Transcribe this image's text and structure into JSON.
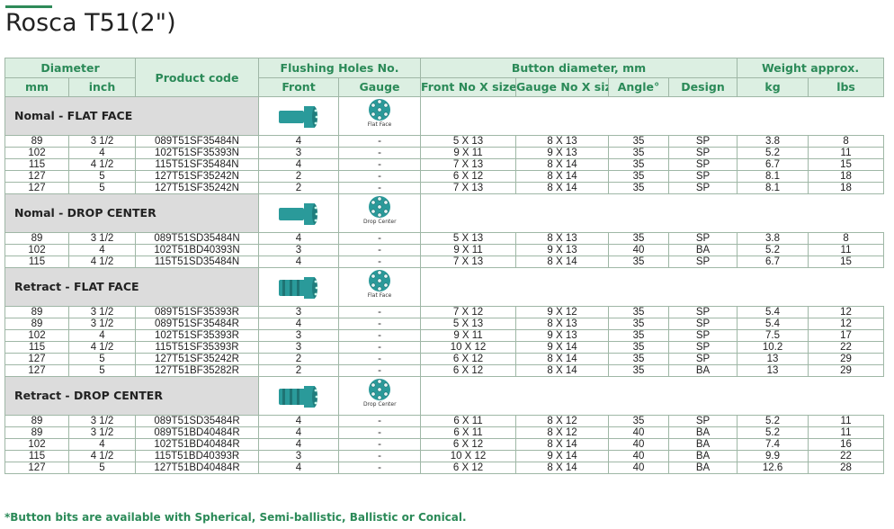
{
  "title": "Rosca T51(2\")",
  "header": {
    "diameter": "Diameter",
    "mm": "mm",
    "inch": "inch",
    "product_code": "Product code",
    "flushing": "Flushing Holes No.",
    "front": "Front",
    "gauge": "Gauge",
    "button_diameter": "Button diameter, mm",
    "front_no_size": "Front No X size",
    "gauge_no_size": "Gauge No X size",
    "angle": "Angle°",
    "design": "Design",
    "weight": "Weight approx.",
    "kg": "kg",
    "lbs": "lbs"
  },
  "sections": [
    {
      "label": "Nomal - FLAT FACE",
      "icon": "flat-face-bit-icon",
      "face_caption": "Flat Face",
      "rows": [
        [
          "89",
          "3 1/2",
          "089T51SF35484N",
          "4",
          "-",
          "5 X 13",
          "8 X 13",
          "35",
          "SP",
          "3.8",
          "8"
        ],
        [
          "102",
          "4",
          "102T51SF35393N",
          "3",
          "-",
          "9 X 11",
          "9 X 13",
          "35",
          "SP",
          "5.2",
          "11"
        ],
        [
          "115",
          "4 1/2",
          "115T51SF35484N",
          "4",
          "-",
          "7 X 13",
          "8 X 14",
          "35",
          "SP",
          "6.7",
          "15"
        ],
        [
          "127",
          "5",
          "127T51SF35242N",
          "2",
          "-",
          "6 X 12",
          "8 X 14",
          "35",
          "SP",
          "8.1",
          "18"
        ],
        [
          "127",
          "5",
          "127T51SF35242N",
          "2",
          "-",
          "7 X 13",
          "8 X 14",
          "35",
          "SP",
          "8.1",
          "18"
        ]
      ]
    },
    {
      "label": "Nomal - DROP CENTER",
      "icon": "drop-center-bit-icon",
      "face_caption": "Drop Center",
      "rows": [
        [
          "89",
          "3 1/2",
          "089T51SD35484N",
          "4",
          "-",
          "5 X 13",
          "8 X 13",
          "35",
          "SP",
          "3.8",
          "8"
        ],
        [
          "102",
          "4",
          "102T51BD40393N",
          "3",
          "-",
          "9 X 11",
          "9 X 13",
          "40",
          "BA",
          "5.2",
          "11"
        ],
        [
          "115",
          "4 1/2",
          "115T51SD35484N",
          "4",
          "-",
          "7 X 13",
          "8 X 14",
          "35",
          "SP",
          "6.7",
          "15"
        ]
      ]
    },
    {
      "label": "Retract - FLAT FACE",
      "icon": "retract-flat-face-bit-icon",
      "face_caption": "Flat Face",
      "rows": [
        [
          "89",
          "3 1/2",
          "089T51SF35393R",
          "3",
          "-",
          "7 X 12",
          "9 X 12",
          "35",
          "SP",
          "5.4",
          "12"
        ],
        [
          "89",
          "3 1/2",
          "089T51SF35484R",
          "4",
          "-",
          "5 X 13",
          "8 X 13",
          "35",
          "SP",
          "5.4",
          "12"
        ],
        [
          "102",
          "4",
          "102T51SF35393R",
          "3",
          "-",
          "9 X 11",
          "9 X 13",
          "35",
          "SP",
          "7.5",
          "17"
        ],
        [
          "115",
          "4 1/2",
          "115T51SF35393R",
          "3",
          "-",
          "10 X 12",
          "9 X 14",
          "35",
          "SP",
          "10.2",
          "22"
        ],
        [
          "127",
          "5",
          "127T51SF35242R",
          "2",
          "-",
          "6 X 12",
          "8 X 14",
          "35",
          "SP",
          "13",
          "29"
        ],
        [
          "127",
          "5",
          "127T51BF35282R",
          "2",
          "-",
          "6 X 12",
          "8 X 14",
          "35",
          "BA",
          "13",
          "29"
        ]
      ]
    },
    {
      "label": "Retract - DROP CENTER",
      "icon": "retract-drop-center-bit-icon",
      "face_caption": "Drop Center",
      "rows": [
        [
          "89",
          "3 1/2",
          "089T51SD35484R",
          "4",
          "-",
          "6 X 11",
          "8 X 12",
          "35",
          "SP",
          "5.2",
          "11"
        ],
        [
          "89",
          "3 1/2",
          "089T51BD40484R",
          "4",
          "-",
          "6 X 11",
          "8 X 12",
          "40",
          "BA",
          "5.2",
          "11"
        ],
        [
          "102",
          "4",
          "102T51BD40484R",
          "4",
          "-",
          "6 X 12",
          "8 X 14",
          "40",
          "BA",
          "7.4",
          "16"
        ],
        [
          "115",
          "4 1/2",
          "115T51BD40393R",
          "3",
          "-",
          "10 X 12",
          "9 X 14",
          "40",
          "BA",
          "9.9",
          "22"
        ],
        [
          "127",
          "5",
          "127T51BD40484R",
          "4",
          "-",
          "6 X 12",
          "8 X 14",
          "40",
          "BA",
          "12.6",
          "28"
        ]
      ]
    }
  ],
  "footnote": "*Button bits are available with Spherical, Semi-ballistic, Ballistic or Conical.",
  "colors": {
    "accent": "#2b8a58",
    "header_bg": "#dcefe2",
    "section_bg": "#dcdcdc",
    "bit_teal": "#2a9a9a"
  }
}
